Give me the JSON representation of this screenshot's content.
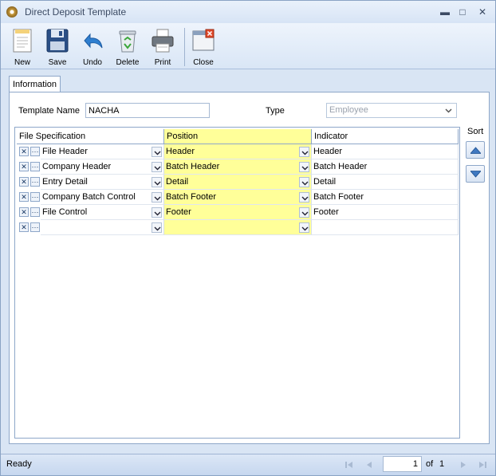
{
  "window": {
    "title": "Direct Deposit Template",
    "controls": {
      "minimize": "▬",
      "maximize": "□",
      "close": "✕"
    }
  },
  "toolbar": {
    "new_label": "New",
    "save_label": "Save",
    "undo_label": "Undo",
    "delete_label": "Delete",
    "print_label": "Print",
    "close_label": "Close"
  },
  "tabs": [
    {
      "label": "Information"
    }
  ],
  "form": {
    "template_name_label": "Template Name",
    "template_name_value": "NACHA",
    "type_label": "Type",
    "type_value": "Employee"
  },
  "grid": {
    "columns": [
      "File Specification",
      "Position",
      "Indicator"
    ],
    "rows": [
      {
        "file_spec": "File Header",
        "position": "Header",
        "indicator": "Header"
      },
      {
        "file_spec": "Company Header",
        "position": "Batch Header",
        "indicator": "Batch Header"
      },
      {
        "file_spec": "Entry Detail",
        "position": "Detail",
        "indicator": "Detail"
      },
      {
        "file_spec": "Company Batch Control",
        "position": "Batch Footer",
        "indicator": "Batch Footer"
      },
      {
        "file_spec": "File Control",
        "position": "Footer",
        "indicator": "Footer"
      },
      {
        "file_spec": "",
        "position": "",
        "indicator": ""
      }
    ],
    "row_icons": {
      "remove": "✕",
      "more": "···"
    }
  },
  "sort": {
    "label": "Sort"
  },
  "status": {
    "text": "Ready",
    "page_value": "1",
    "of_label": "of",
    "total_pages": "1"
  },
  "colors": {
    "highlight": "#ffff99",
    "border": "#8ea7c9",
    "chrome": "#d9e5f4"
  }
}
